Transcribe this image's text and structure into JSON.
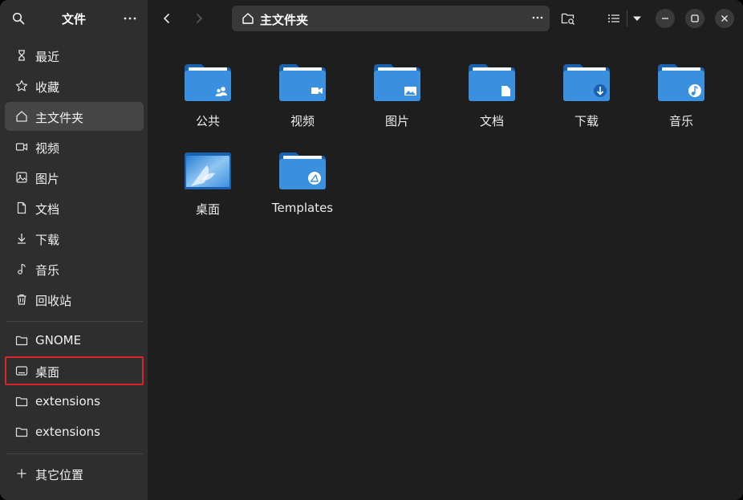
{
  "app": {
    "title": "文件"
  },
  "sidebar": {
    "places": [
      {
        "label": "最近",
        "icon": "clock-icon"
      },
      {
        "label": "收藏",
        "icon": "star-icon"
      },
      {
        "label": "主文件夹",
        "icon": "home-icon",
        "active": true
      },
      {
        "label": "视频",
        "icon": "video-icon"
      },
      {
        "label": "图片",
        "icon": "image-icon"
      },
      {
        "label": "文档",
        "icon": "document-icon"
      },
      {
        "label": "下载",
        "icon": "download-icon"
      },
      {
        "label": "音乐",
        "icon": "music-icon"
      },
      {
        "label": "回收站",
        "icon": "trash-icon"
      }
    ],
    "bookmarks": [
      {
        "label": "GNOME",
        "icon": "folder-icon"
      },
      {
        "label": "桌面",
        "icon": "drive-icon",
        "focused": true
      },
      {
        "label": "extensions",
        "icon": "folder-icon"
      },
      {
        "label": "extensions",
        "icon": "folder-icon"
      }
    ],
    "other": {
      "label": "其它位置",
      "icon": "plus-icon"
    }
  },
  "path": {
    "current": "主文件夹"
  },
  "files": [
    {
      "name": "公共",
      "emblem": "people"
    },
    {
      "name": "视频",
      "emblem": "video"
    },
    {
      "name": "图片",
      "emblem": "image"
    },
    {
      "name": "文档",
      "emblem": "document"
    },
    {
      "name": "下载",
      "emblem": "download"
    },
    {
      "name": "音乐",
      "emblem": "music"
    },
    {
      "name": "桌面",
      "emblem": "desktop"
    },
    {
      "name": "Templates",
      "emblem": "template"
    }
  ],
  "colors": {
    "sidebar_bg": "#2e2e2e",
    "content_bg": "#1e1e1e",
    "folder": "#3a8fde",
    "focus": "#d7262b"
  }
}
